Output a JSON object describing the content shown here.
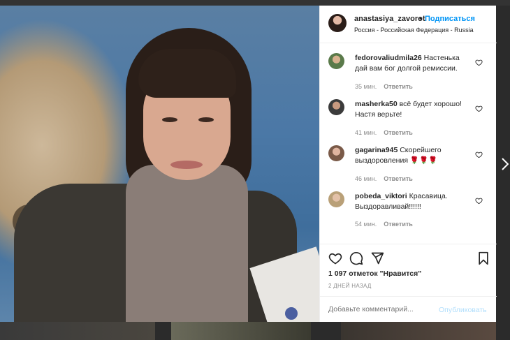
{
  "post": {
    "username": "anastasiya_zavorot",
    "dot": "•",
    "follow_label": "Подписаться",
    "location": "Россия - Российская Федерация - Russia"
  },
  "comments": [
    {
      "user": "fedorovaliudmila26",
      "text": "Настенька дай вам бог долгой ремиссии.",
      "time": "35 мин.",
      "reply": "Ответить"
    },
    {
      "user": "masherka50",
      "text": "всё будет хорошо! Настя верьте!",
      "time": "41 мин.",
      "reply": "Ответить"
    },
    {
      "user": "gagarina945",
      "text": "Скорейшего выздоровления 🌹🌹🌹",
      "time": "46 мин.",
      "reply": "Ответить"
    },
    {
      "user": "pobeda_viktori",
      "text": "Красавица. Выздоравливай!!!!!!",
      "time": "54 мин.",
      "reply": "Ответить"
    }
  ],
  "stats": {
    "likes": "1 097 отметок \"Нравится\"",
    "date": "2 ДНЕЙ НАЗАД"
  },
  "composer": {
    "placeholder": "Добавьте комментарий...",
    "publish_label": "Опубликовать"
  },
  "icons": {
    "like": "heart-icon",
    "comment": "comment-icon",
    "share": "share-icon",
    "save": "bookmark-icon",
    "next": "chevron-right-icon"
  },
  "colors": {
    "accent": "#0095f6",
    "publish_disabled": "#b2dffc",
    "muted": "#8e8e8e"
  }
}
